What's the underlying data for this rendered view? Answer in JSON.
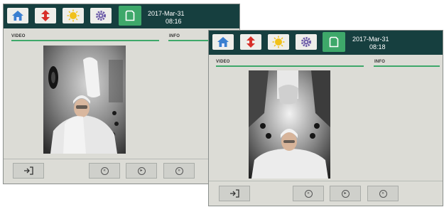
{
  "screen_back": {
    "date": "2017-Mar-31",
    "time": "08:16",
    "video_label": "VIDEO",
    "info_label": "INFO"
  },
  "screen_front": {
    "date": "2017-Mar-31",
    "time": "08:18",
    "video_label": "VIDEO",
    "info_label": "INFO"
  },
  "nav_icons": [
    "home-icon",
    "transfer-icon",
    "sun-icon",
    "gear-icon",
    "page-icon"
  ],
  "controls": [
    "exit-icon",
    "previous-icon",
    "play-icon",
    "next-icon"
  ],
  "colors": {
    "header_bg": "#163f3f",
    "accent_green": "#3ea86a",
    "panel_bg": "#dcdcd6",
    "home_blue": "#3a7fd0",
    "transfer_red": "#d8302a",
    "sun_yellow": "#f1c11a",
    "gear_purple": "#6b5aa8"
  }
}
